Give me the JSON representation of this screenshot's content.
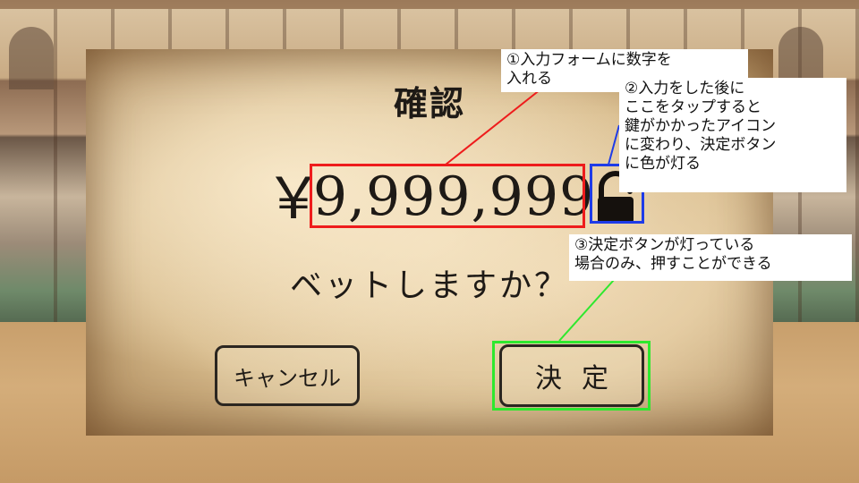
{
  "dialog": {
    "title": "確認",
    "currency_symbol": "￥",
    "amount_value": "9,999,999",
    "lock_state": "unlocked",
    "question": "ベットしますか？",
    "cancel_label": "キャンセル",
    "decide_label": "決定"
  },
  "annotations": {
    "note1": "①入力フォームに数字を\n入れる",
    "note2": "②入力をした後に\nここをタップすると\n鍵がかかったアイコン\nに変わり、決定ボタン\nに色が灯る",
    "note3": "③決定ボタンが灯っている\n場合のみ、押すことができる"
  },
  "colors": {
    "note1_marker": "#ee1c1c",
    "note2_marker": "#1e3be8",
    "note3_marker": "#2ee82e",
    "text": "#1e1a16"
  },
  "icons": {
    "lock": "lock-icon"
  }
}
